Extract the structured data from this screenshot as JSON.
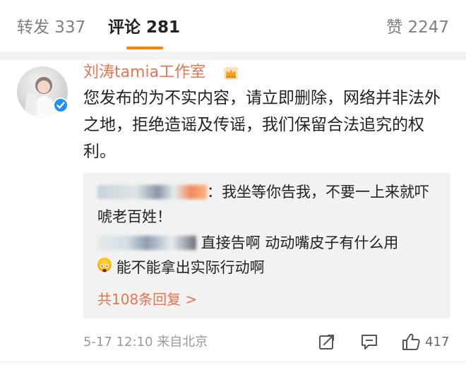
{
  "tabs": {
    "repost": "转发 337",
    "comments": "评论 281",
    "likes": "赞 2247"
  },
  "comment": {
    "username": "刘涛tamia工作室",
    "avatar_icon": "user-avatar",
    "verified_icon": "verified-badge-icon",
    "badge_icon": "crown-icon",
    "text": "您发布的为不实内容，请立即删除，网络并非法外之地，拒绝造谣及传谣，我们保留合法追究的权利。",
    "time": "5-17 12:10",
    "source": "来自北京",
    "like_count": "417"
  },
  "replies": [
    {
      "text": "：我坐等你告我，不要一上来就吓唬老百姓！"
    },
    {
      "text": " 直接告啊 动动嘴皮子有什么用",
      "text2": "能不能拿出实际行动啊"
    }
  ],
  "more_replies": "共108条回复 >",
  "colors": {
    "accent": "#ff8200",
    "username": "#eb7350",
    "verified": "#1e90ff",
    "reply_bg": "#f2f2f2"
  },
  "icons": [
    "share-icon",
    "comment-icon",
    "like-icon",
    "emoji-icon"
  ]
}
